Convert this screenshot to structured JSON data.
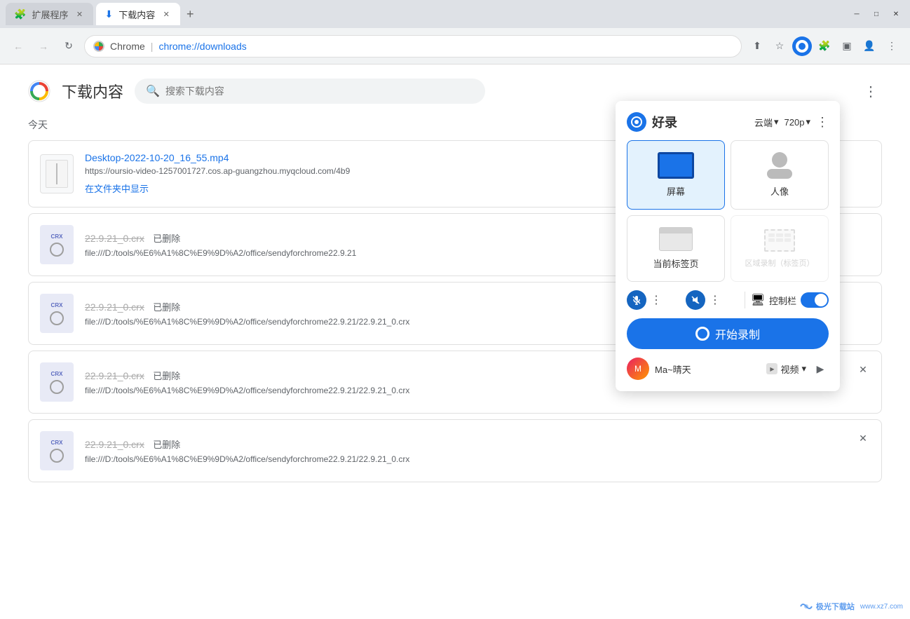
{
  "tabs": [
    {
      "id": "tab1",
      "label": "扩展程序",
      "active": false,
      "icon": "puzzle"
    },
    {
      "id": "tab2",
      "label": "下载内容",
      "active": true,
      "icon": "download"
    }
  ],
  "address_bar": {
    "brand": "Chrome",
    "separator": "|",
    "url": "chrome://downloads"
  },
  "page": {
    "title": "下载内容",
    "search_placeholder": "搜索下载内容"
  },
  "section": {
    "label": "今天"
  },
  "downloads": [
    {
      "id": "dl1",
      "name": "Desktop-2022-10-20_16_55.mp4",
      "url": "https://oursio-video-1257001727.cos.ap-guangzhou.myqcloud.com/4b9",
      "action": "在文件夹中显示",
      "type": "doc",
      "deleted": false,
      "showClose": false
    },
    {
      "id": "dl2",
      "name": "22.9.21_0.crx",
      "url": "file:///D:/tools/%E6%A1%8C%E9%9D%A2/office/sendyforchrome22.9.21",
      "type": "crx",
      "deleted": true,
      "deletedLabel": "已删除",
      "showClose": false
    },
    {
      "id": "dl3",
      "name": "22.9.21_0.crx",
      "url": "file:///D:/tools/%E6%A1%8C%E9%9D%A2/office/sendyforchrome22.9.21/22.9.21_0.crx",
      "type": "crx",
      "deleted": true,
      "deletedLabel": "已删除",
      "showClose": false
    },
    {
      "id": "dl4",
      "name": "22.9.21_0.crx",
      "url": "file:///D:/tools/%E6%A1%8C%E9%9D%A2/office/sendyforchrome22.9.21/22.9.21_0.crx",
      "type": "crx",
      "deleted": true,
      "deletedLabel": "已删除",
      "showClose": true
    },
    {
      "id": "dl5",
      "name": "22.9.21_0.crx",
      "url": "file:///D:/tools/%E6%A1%8C%E9%9D%A2/office/sendyforchrome22.9.21/22.9.21_0.crx",
      "type": "crx",
      "deleted": true,
      "deletedLabel": "已删除",
      "showClose": true
    }
  ],
  "popup": {
    "brand": "好录",
    "cloud_label": "云端",
    "quality_label": "720p",
    "modes": [
      {
        "id": "screen",
        "label": "屏幕",
        "active": true,
        "type": "screen"
      },
      {
        "id": "person",
        "label": "人像",
        "active": false,
        "type": "person"
      },
      {
        "id": "tab",
        "label": "当前标签页",
        "active": false,
        "type": "tab"
      },
      {
        "id": "region",
        "label": "区域录制（标签页）",
        "active": false,
        "type": "region",
        "disabled": true
      }
    ],
    "audio": {
      "mic_muted": false,
      "system_muted": false,
      "control_bar_label": "控制栏",
      "toggle_on": true
    },
    "start_btn_label": "开始录制",
    "user": {
      "name": "Ma~晴天",
      "video_label": "视频"
    }
  },
  "watermark": {
    "text": "极光下载站",
    "url_text": "www.xz7.com"
  }
}
